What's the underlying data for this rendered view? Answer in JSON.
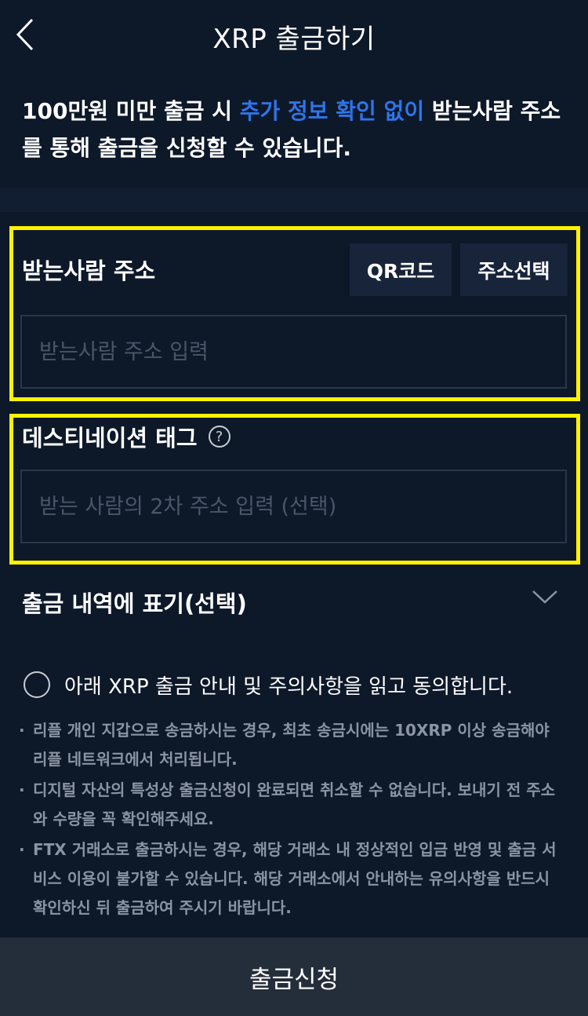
{
  "header": {
    "title": "XRP 출금하기",
    "back_icon": "chevron-left-icon"
  },
  "notice": {
    "prefix": "100만원 미만 출금 시 ",
    "highlight": "추가 정보 확인 없이",
    "suffix": " 받는사람 주소를 통해 출금을 신청할 수 있습니다.",
    "highlight_color": "#2f74e9"
  },
  "address": {
    "label": "받는사람 주소",
    "qr_button": "QR코드",
    "select_button": "주소선택",
    "placeholder": "받는사람 주소 입력"
  },
  "destination_tag": {
    "label": "데스티네이션 태그",
    "help_icon": "question-circle-icon",
    "placeholder": "받는 사람의 2차 주소 입력 (선택)"
  },
  "memo": {
    "label": "출금 내역에 표기(선택)",
    "icon": "chevron-down-icon"
  },
  "agreement": {
    "text": "아래 XRP 출금 안내 및 주의사항을 읽고 동의합니다.",
    "checked": false
  },
  "notes": [
    "리플 개인 지갑으로 송금하시는 경우, 최초 송금시에는 10XRP 이상 송금해야 리플 네트워크에서 처리됩니다.",
    "디지털 자산의 특성상 출금신청이 완료되면 취소할 수 없습니다. 보내기 전 주소와 수량을 꼭 확인해주세요.",
    "FTX 거래소로 출금하시는 경우, 해당 거래소 내 정상적인 입금 반영 및 출금 서비스 이용이 불가할 수 있습니다. 해당 거래소에서 안내하는 유의사항을 반드시 확인하신 뒤 출금하여 주시기 바랍니다."
  ],
  "submit": {
    "label": "출금신청"
  },
  "colors": {
    "background": "#0d1829",
    "highlight_border": "#fff200",
    "accent": "#2f74e9"
  }
}
